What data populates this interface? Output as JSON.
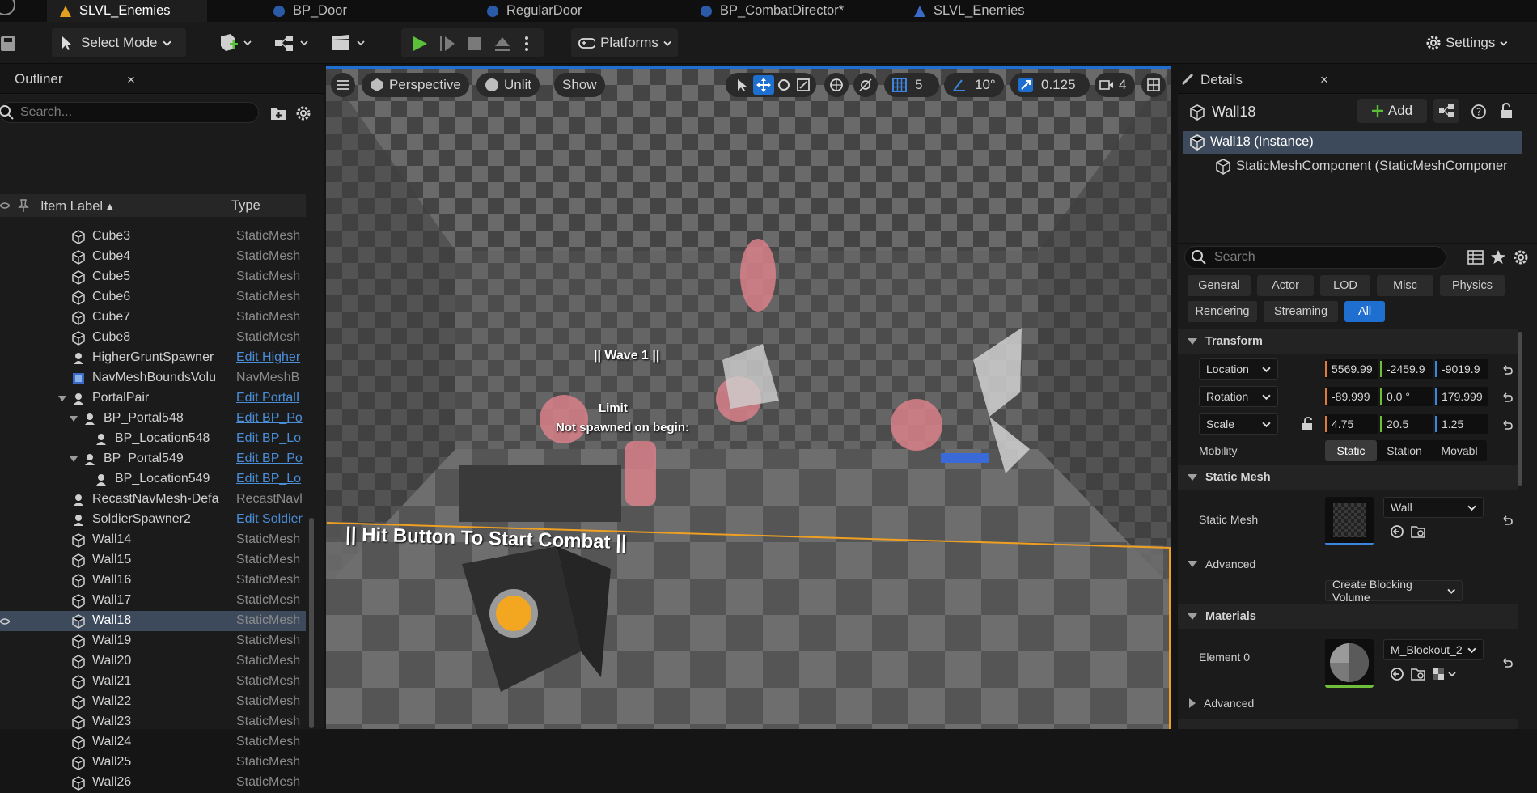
{
  "tabs": [
    {
      "label": "SLVL_Enemies",
      "icon": "level-icon",
      "active": true
    },
    {
      "label": "BP_Door",
      "icon": "blueprint-icon"
    },
    {
      "label": "RegularDoor",
      "icon": "blueprint-icon"
    },
    {
      "label": "BP_CombatDirector*",
      "icon": "blueprint-icon"
    },
    {
      "label": "SLVL_Enemies",
      "icon": "level-icon"
    }
  ],
  "toolbar": {
    "select_mode": "Select Mode",
    "platforms": "Platforms",
    "settings": "Settings"
  },
  "outliner": {
    "title": "Outliner",
    "close": "×",
    "search_placeholder": "Search...",
    "col_label": "Item Label ▴",
    "col_type": "Type",
    "rows": [
      {
        "label": "Cube3",
        "type": "StaticMesh",
        "indent": 1,
        "icon": "static-mesh-icon"
      },
      {
        "label": "Cube4",
        "type": "StaticMesh",
        "indent": 1,
        "icon": "static-mesh-icon"
      },
      {
        "label": "Cube5",
        "type": "StaticMesh",
        "indent": 1,
        "icon": "static-mesh-icon"
      },
      {
        "label": "Cube6",
        "type": "StaticMesh",
        "indent": 1,
        "icon": "static-mesh-icon"
      },
      {
        "label": "Cube7",
        "type": "StaticMesh",
        "indent": 1,
        "icon": "static-mesh-icon"
      },
      {
        "label": "Cube8",
        "type": "StaticMesh",
        "indent": 1,
        "icon": "static-mesh-icon"
      },
      {
        "label": "HigherGruntSpawner",
        "type": "Edit Higher",
        "link": true,
        "indent": 1,
        "icon": "actor-icon"
      },
      {
        "label": "NavMeshBoundsVolu",
        "type": "NavMeshB",
        "indent": 1,
        "icon": "volume-icon"
      },
      {
        "label": "PortalPair",
        "type": "Edit PortalI",
        "link": true,
        "indent": 1,
        "icon": "actor-icon",
        "expand": true
      },
      {
        "label": "BP_Portal548",
        "type": "Edit BP_Po",
        "link": true,
        "indent": 2,
        "icon": "actor-icon",
        "expand": true
      },
      {
        "label": "BP_Location548",
        "type": "Edit BP_Lo",
        "link": true,
        "indent": 3,
        "icon": "actor-icon"
      },
      {
        "label": "BP_Portal549",
        "type": "Edit BP_Po",
        "link": true,
        "indent": 2,
        "icon": "actor-icon",
        "expand": true
      },
      {
        "label": "BP_Location549",
        "type": "Edit BP_Lo",
        "link": true,
        "indent": 3,
        "icon": "actor-icon"
      },
      {
        "label": "RecastNavMesh-Defa",
        "type": "RecastNavl",
        "indent": 1,
        "icon": "actor-icon"
      },
      {
        "label": "SoldierSpawner2",
        "type": "Edit Soldier",
        "link": true,
        "indent": 1,
        "icon": "actor-icon"
      },
      {
        "label": "Wall14",
        "type": "StaticMesh",
        "indent": 1,
        "icon": "static-mesh-icon"
      },
      {
        "label": "Wall15",
        "type": "StaticMesh",
        "indent": 1,
        "icon": "static-mesh-icon"
      },
      {
        "label": "Wall16",
        "type": "StaticMesh",
        "indent": 1,
        "icon": "static-mesh-icon"
      },
      {
        "label": "Wall17",
        "type": "StaticMesh",
        "indent": 1,
        "icon": "static-mesh-icon"
      },
      {
        "label": "Wall18",
        "type": "StaticMesh",
        "indent": 1,
        "icon": "static-mesh-icon",
        "selected": true
      },
      {
        "label": "Wall19",
        "type": "StaticMesh",
        "indent": 1,
        "icon": "static-mesh-icon"
      },
      {
        "label": "Wall20",
        "type": "StaticMesh",
        "indent": 1,
        "icon": "static-mesh-icon"
      },
      {
        "label": "Wall21",
        "type": "StaticMesh",
        "indent": 1,
        "icon": "static-mesh-icon"
      },
      {
        "label": "Wall22",
        "type": "StaticMesh",
        "indent": 1,
        "icon": "static-mesh-icon"
      },
      {
        "label": "Wall23",
        "type": "StaticMesh",
        "indent": 1,
        "icon": "static-mesh-icon"
      },
      {
        "label": "Wall24",
        "type": "StaticMesh",
        "indent": 1,
        "icon": "static-mesh-icon"
      },
      {
        "label": "Wall25",
        "type": "StaticMesh",
        "indent": 1,
        "icon": "static-mesh-icon"
      },
      {
        "label": "Wall26",
        "type": "StaticMesh",
        "indent": 1,
        "icon": "static-mesh-icon"
      }
    ]
  },
  "viewport": {
    "perspective": "Perspective",
    "unlit": "Unlit",
    "show": "Show",
    "grid_snap": "5",
    "rot_snap": "10°",
    "scale_snap": "0.125",
    "cam_speed": "4",
    "overlay_wave": "|| Wave 1 ||",
    "overlay_limit": "Limit",
    "overlay_not_spawned": "Not spawned on begin:",
    "overlay_hit_button": "|| Hit Button To Start Combat ||"
  },
  "details": {
    "title": "Details",
    "close": "×",
    "actor_name": "Wall18",
    "add_label": "Add",
    "instance_label": "Wall18 (Instance)",
    "component_label": "StaticMeshComponent (StaticMeshComponer",
    "search_placeholder": "Search",
    "filter_tabs_row1": [
      "General",
      "Actor",
      "LOD",
      "Misc",
      "Physics"
    ],
    "filter_tabs_row2": [
      "Rendering",
      "Streaming",
      "All"
    ],
    "active_filter": "All",
    "transform_section": "Transform",
    "location_label": "Location",
    "rotation_label": "Rotation",
    "scale_label": "Scale",
    "location": [
      "5569.99",
      "-2459.9",
      "-9019.9"
    ],
    "rotation": [
      "-89.999",
      "0.0 °",
      "179.999"
    ],
    "scale": [
      "4.75",
      "20.5",
      "1.25"
    ],
    "mobility_label": "Mobility",
    "mobility_options": [
      "Static",
      "Station",
      "Movabl"
    ],
    "static_mesh_section": "Static Mesh",
    "static_mesh_label": "Static Mesh",
    "static_mesh_value": "Wall",
    "advanced_label": "Advanced",
    "blocking_volume": "Create Blocking Volume",
    "materials_section": "Materials",
    "element0_label": "Element 0",
    "element0_value": "M_Blockout_2",
    "advanced2_label": "Advanced"
  },
  "colors": {
    "accent": "#1f6fd0",
    "selection": "#3d4a5c",
    "link": "#4a8ed8",
    "play_green": "#5bbf3a",
    "axis_x": "#e07b39",
    "axis_y": "#6fbf3a",
    "axis_z": "#3a86e0"
  }
}
